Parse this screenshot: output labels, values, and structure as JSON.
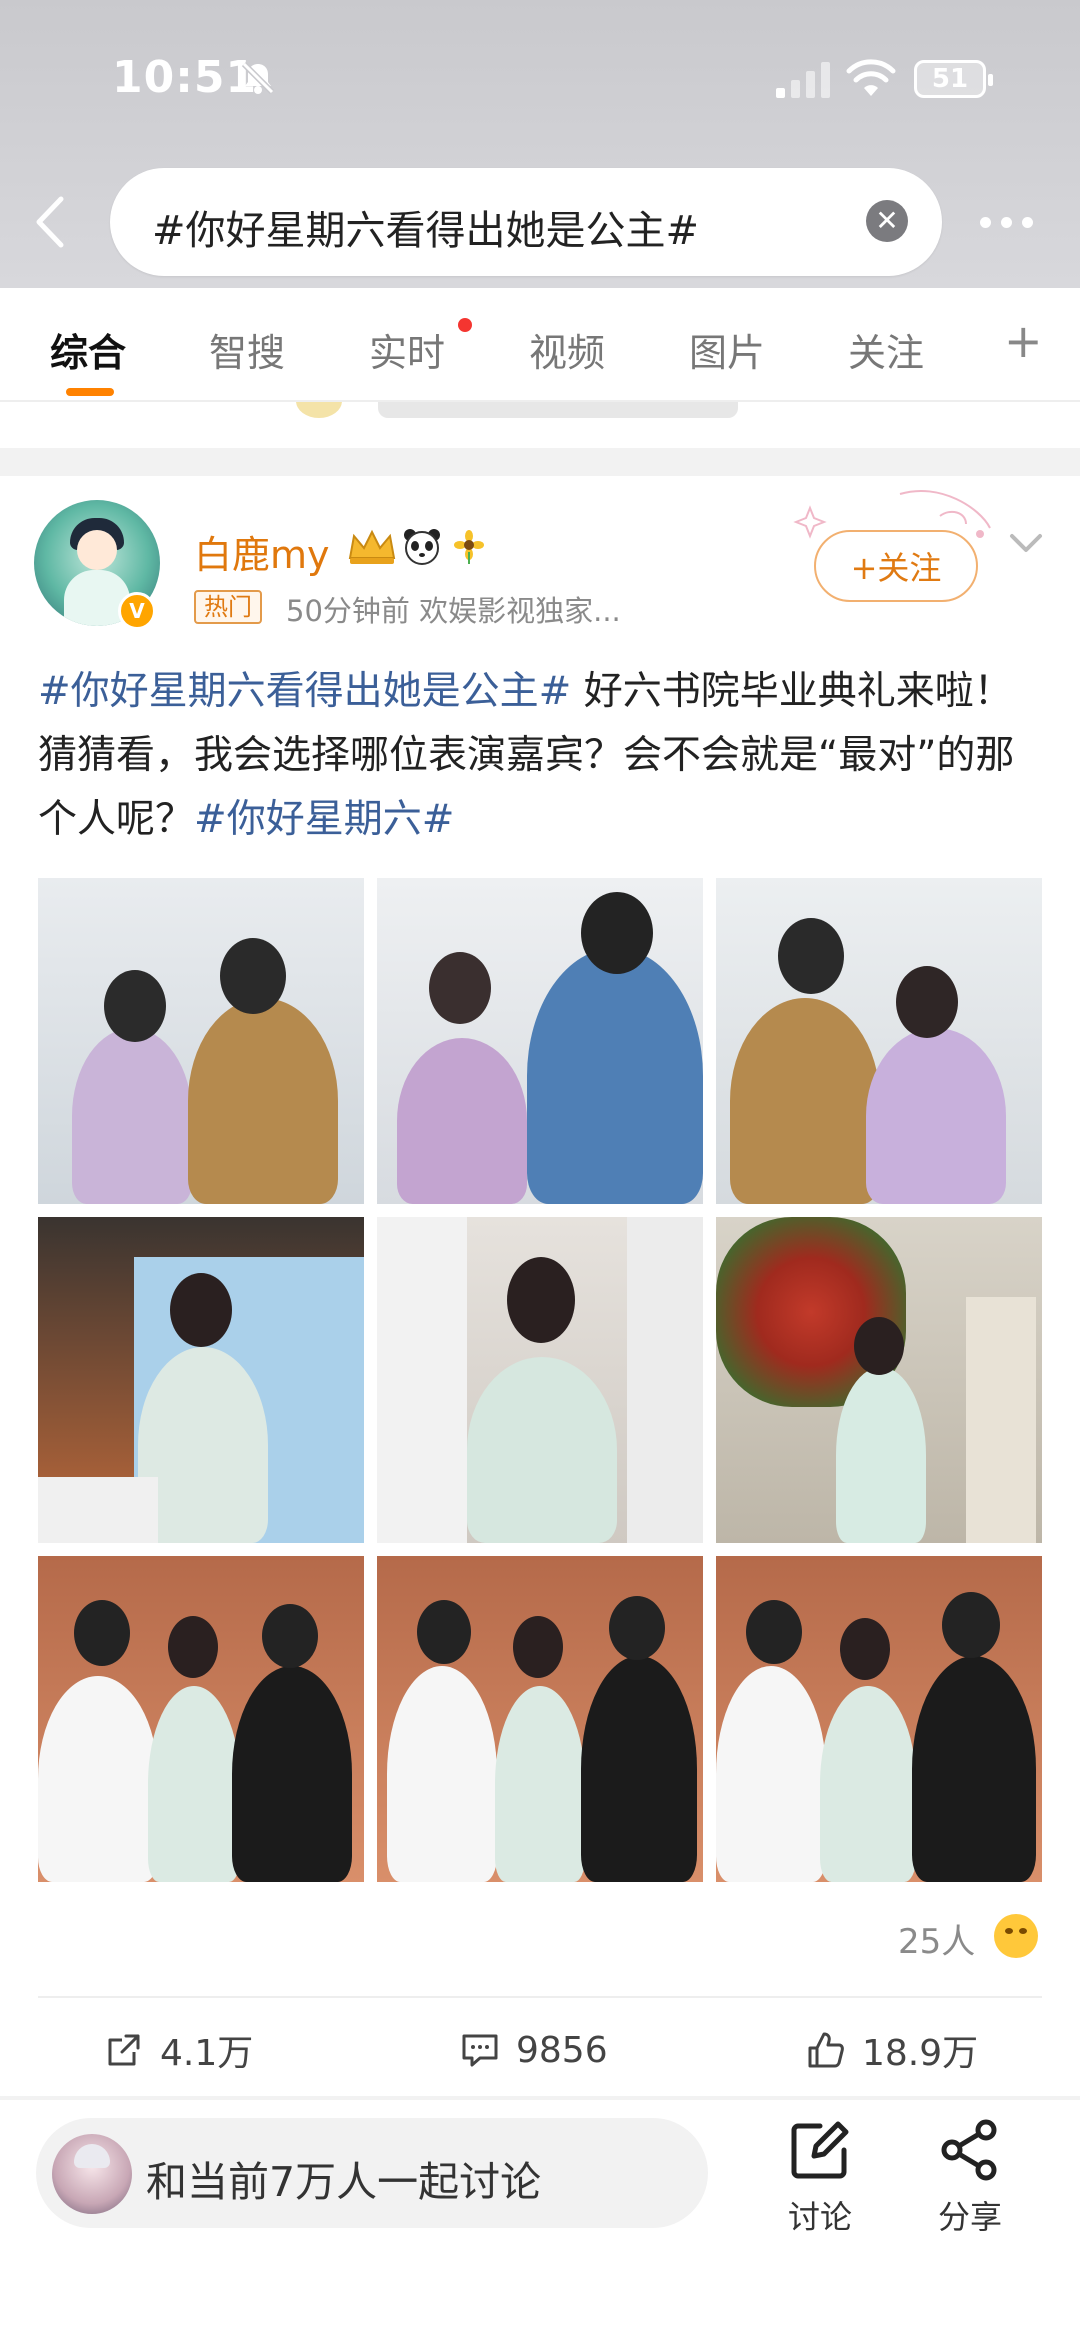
{
  "status_bar": {
    "time": "10:51",
    "battery": "51"
  },
  "search": {
    "query": "#你好星期六看得出她是公主#"
  },
  "tabs": [
    {
      "label": "综合",
      "active": true
    },
    {
      "label": "智搜",
      "active": false
    },
    {
      "label": "实时",
      "active": false,
      "dot": true
    },
    {
      "label": "视频",
      "active": false
    },
    {
      "label": "图片",
      "active": false
    },
    {
      "label": "关注",
      "active": false
    }
  ],
  "post": {
    "username": "白鹿my",
    "badge": "热门",
    "meta": "50分钟前  欢娱影视独家...",
    "follow_label": "+关注",
    "text": {
      "topic1": "#你好星期六看得出她是公主#",
      "body": " 好六书院毕业典礼来啦！猜猜看，我会选择哪位表演嘉宾？会不会就是“最对”的那个人呢？",
      "topic2": "#你好星期六#"
    },
    "images_count": 9,
    "reactions": "25人",
    "actions": {
      "repost": "4.1万",
      "comments": "9856",
      "likes": "18.9万"
    }
  },
  "bottom_bar": {
    "discuss": "和当前7万人一起讨论",
    "discuss_btn": "讨论",
    "share_btn": "分享"
  },
  "colors": {
    "accent": "#ff8200",
    "topic": "#3b5f98",
    "username": "#e0780d"
  }
}
